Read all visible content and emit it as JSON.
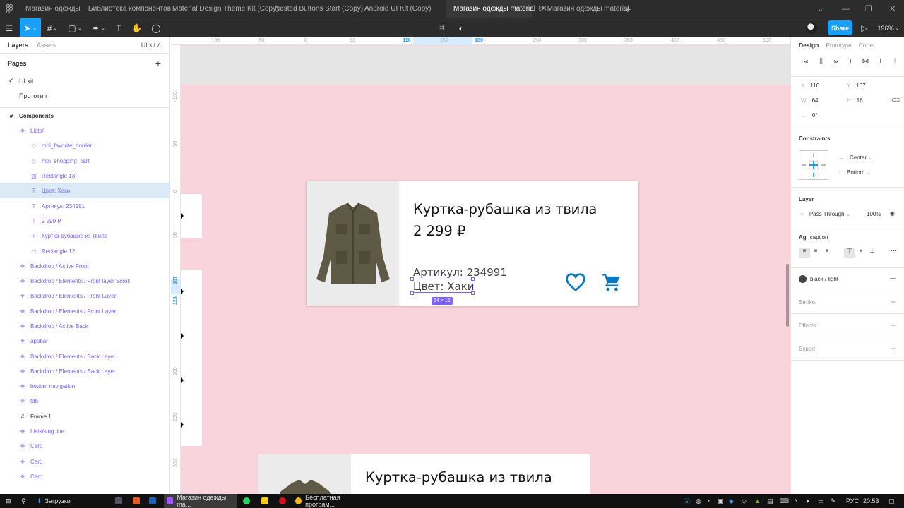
{
  "tabs": {
    "items": [
      {
        "label": "Магазин одежды"
      },
      {
        "label": "Библиотека компонентов"
      },
      {
        "label": "Material Design Theme Kit (Copy)"
      },
      {
        "label": "Nested Buttons Start (Copy)"
      },
      {
        "label": "Android UI Kit (Copy)"
      },
      {
        "label": "Магазин одежды material",
        "active": true
      },
      {
        "label": "Магазин одежды material",
        "prototype": true
      }
    ],
    "add": "+"
  },
  "toolbar": {
    "share_label": "Share",
    "zoom": "196%"
  },
  "layers_panel": {
    "layers_tab": "Layers",
    "assets_tab": "Assets",
    "page_switch": "UI kit",
    "pages_heading": "Pages",
    "add_page": "+",
    "pages": [
      {
        "label": "UI kit",
        "selected": true
      },
      {
        "label": "Прототип"
      }
    ],
    "frame_name": "Components",
    "layers": [
      {
        "label": "Lists/",
        "icon": "component-icon"
      },
      {
        "label": "mdi_favorite_border",
        "icon": "instance-icon"
      },
      {
        "label": "mdi_shopping_cart",
        "icon": "instance-icon"
      },
      {
        "label": "Rectangle 13",
        "icon": "image-icon"
      },
      {
        "label": "Цвет: Хаки",
        "icon": "text-icon",
        "selected": true
      },
      {
        "label": "Артикул: 234991",
        "icon": "text-icon"
      },
      {
        "label": "2 299 ₽",
        "icon": "text-icon"
      },
      {
        "label": "Куртка-рубашка из твила",
        "icon": "text-icon"
      },
      {
        "label": "Rectangle 12",
        "icon": "rectangle-icon"
      },
      {
        "label": "Backdrop / Active Front",
        "icon": "component-icon"
      },
      {
        "label": "Backdrop / Elements / Front layer Scroll",
        "icon": "component-icon"
      },
      {
        "label": "Backdrop / Elements / Front Layer",
        "icon": "component-icon"
      },
      {
        "label": "Backdrop / Elements / Front Layer",
        "icon": "component-icon"
      },
      {
        "label": "Backdrop / Active Back",
        "icon": "component-icon"
      },
      {
        "label": "appbar",
        "icon": "component-icon"
      },
      {
        "label": "Backdrop / Elements / Back Layer",
        "icon": "component-icon"
      },
      {
        "label": "Backdrop / Elements / Back Layer",
        "icon": "component-icon"
      },
      {
        "label": "bottom navigation",
        "icon": "component-icon"
      },
      {
        "label": "tab",
        "icon": "component-icon"
      },
      {
        "label": "Frame 1",
        "icon": "frame-icon"
      },
      {
        "label": "Lists/sing line",
        "icon": "component-icon"
      },
      {
        "label": "Card",
        "icon": "component-icon"
      },
      {
        "label": "Card",
        "icon": "component-icon"
      },
      {
        "label": "Card",
        "icon": "component-icon"
      }
    ]
  },
  "canvas": {
    "ruler_top": [
      "-100",
      "-50",
      "0",
      "50",
      "116",
      "150",
      "180",
      "250",
      "300",
      "350",
      "400",
      "450",
      "500"
    ],
    "ruler_left": [
      "-100",
      "-50",
      "0",
      "50",
      "107",
      "123",
      "200",
      "250",
      "300"
    ],
    "card": {
      "title": "Куртка-рубашка из твила",
      "price": "2 299 ₽",
      "sku": "Артикул: 234991",
      "color": "Цвет: Хаки"
    },
    "selection_size": "64 × 16",
    "card2_title": "Куртка-рубашка из твила",
    "help": "?"
  },
  "design_panel": {
    "tabs": [
      "Design",
      "Prototype",
      "Code"
    ],
    "x_label": "X",
    "x": "116",
    "y_label": "Y",
    "y": "107",
    "w_label": "W",
    "w": "64",
    "h_label": "H",
    "h": "16",
    "rotation": "0°",
    "constraints_title": "Constraints",
    "constraint_h": "Center",
    "constraint_v": "Bottom",
    "layer_title": "Layer",
    "blend": "Pass Through",
    "opacity": "100%",
    "text_style_prefix": "Ag",
    "text_style": "caption",
    "fill_style": "black / light",
    "stroke_title": "Stroke",
    "effects_title": "Effects",
    "export_title": "Export"
  },
  "taskbar": {
    "downloads": "Загрузки",
    "figma_window": "Магазин одежды ma...",
    "browser_window": "Бесплатная програм...",
    "language": "РУС",
    "time": "20:53"
  },
  "colors": {
    "accent": "#18a0fb",
    "component": "#7b61ff",
    "canvas_bg": "#fad4dc",
    "icon_blue": "#0b79c2"
  }
}
